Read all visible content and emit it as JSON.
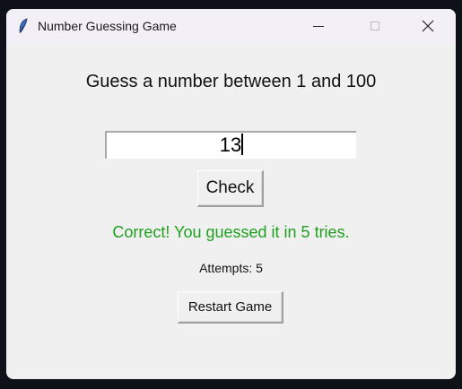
{
  "window": {
    "title": "Number Guessing Game",
    "icon": "feather-icon"
  },
  "heading": "Guess a number between 1 and 100",
  "entry": {
    "value": "13"
  },
  "check_label": "Check",
  "result_message": "Correct! You guessed it in 5 tries.",
  "result_color": "#1fa01f",
  "attempts": "Attempts: 5",
  "restart_label": "Restart Game"
}
